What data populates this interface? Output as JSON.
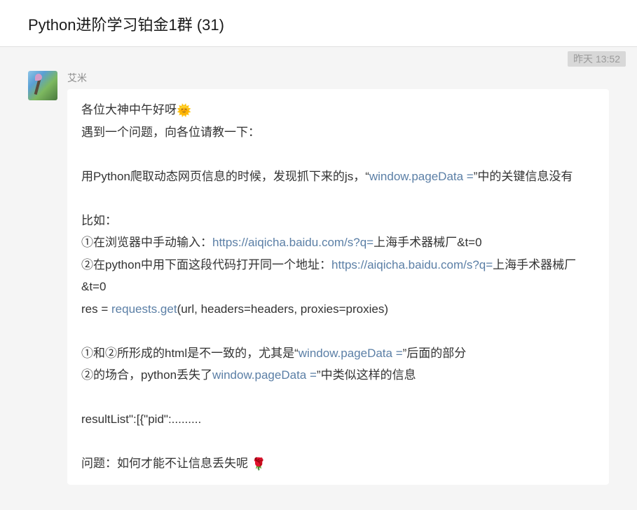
{
  "header": {
    "title": "Python进阶学习铂金1群 (31)"
  },
  "timestamp": "昨天 13:52",
  "message": {
    "sender": "艾米",
    "lines": {
      "greeting": "各位大神中午好呀",
      "greeting_emoji": "🌞",
      "intro": "遇到一个问题，向各位请教一下：",
      "desc_before_link": "用Python爬取动态网页信息的时候，发现抓下来的js，“",
      "desc_link": "window.pageData =",
      "desc_after_link": "”中的关键信息没有",
      "eg_label": "比如：",
      "step1_text": "①在浏览器中手动输入：",
      "step1_url": "https://aiqicha.baidu.com/s?q=",
      "step1_suffix": "上海手术器械厂&t=0",
      "step2_text": "②在python中用下面这段代码打开同一个地址：",
      "step2_url": "https://aiqicha.baidu.com/s?q=",
      "step2_suffix": "上海手术器械厂&t=0",
      "code_prefix": "res = ",
      "code_link": "requests.get",
      "code_suffix": "(url, headers=headers, proxies=proxies)",
      "compare_before": "①和②所形成的html是不一致的，尤其是“",
      "compare_link": "window.pageData =",
      "compare_after": "”后面的部分",
      "loss_before": "②的场合，python丢失了",
      "loss_link": "window.pageData =",
      "loss_after": "”中类似这样的信息",
      "result_sample": "resultList\":[{\"pid\":.........",
      "question": "问题：如何才能不让信息丢失呢 ",
      "question_emoji": "🌹"
    }
  }
}
